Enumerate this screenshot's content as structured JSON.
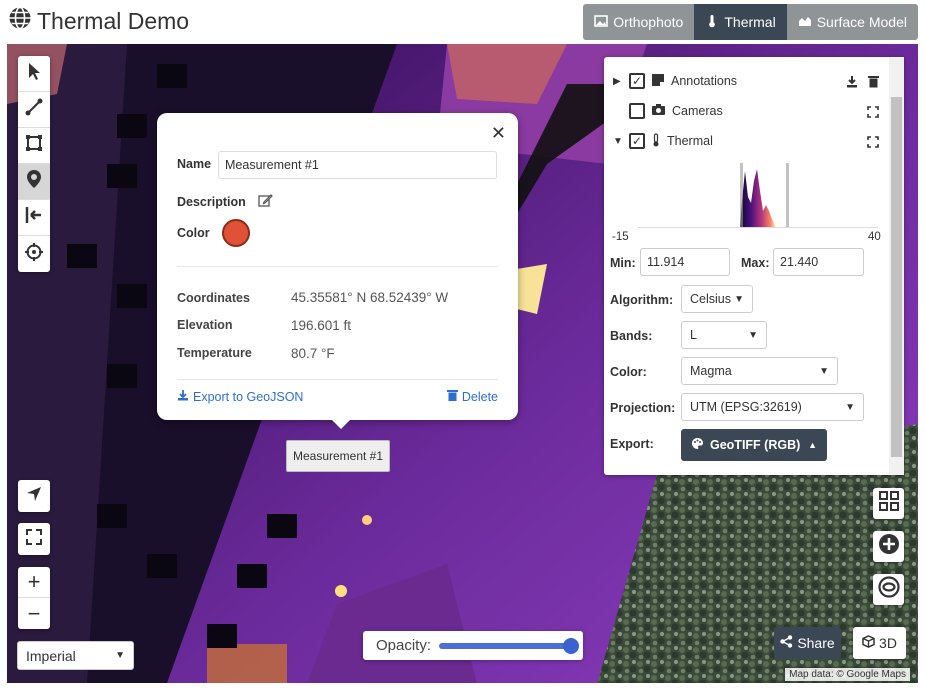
{
  "app": {
    "title": "Thermal Demo"
  },
  "modes": [
    {
      "label": "Orthophoto",
      "active": false
    },
    {
      "label": "Thermal",
      "active": true
    },
    {
      "label": "Surface Model",
      "active": false
    }
  ],
  "popup": {
    "name_label": "Name",
    "name_value": "Measurement #1",
    "description_label": "Description",
    "color_label": "Color",
    "color_value": "#e05236",
    "coordinates_label": "Coordinates",
    "coordinates_value": "45.35581° N 68.52439° W",
    "elevation_label": "Elevation",
    "elevation_value": "196.601 ft",
    "temperature_label": "Temperature",
    "temperature_value": "80.7 °F",
    "export_label": "Export to GeoJSON",
    "delete_label": "Delete"
  },
  "marker_tag": "Measurement #1",
  "layers": {
    "items": [
      {
        "label": "Annotations",
        "checked": true
      },
      {
        "label": "Cameras",
        "checked": false
      },
      {
        "label": "Thermal",
        "checked": true
      }
    ],
    "histogram_min_label": "-15",
    "histogram_max_label": "40",
    "min_label": "Min:",
    "min_value": "11.914",
    "max_label": "Max:",
    "max_value": "21.440",
    "algorithm_label": "Algorithm:",
    "algorithm_value": "Celsius",
    "bands_label": "Bands:",
    "bands_value": "L",
    "color_label": "Color:",
    "color_value": "Magma",
    "projection_label": "Projection:",
    "projection_value": "UTM (EPSG:32619)",
    "export_label": "Export:",
    "export_value": "GeoTIFF (RGB)"
  },
  "controls": {
    "units_value": "Imperial",
    "opacity_label": "Opacity:",
    "opacity_value": 1.0,
    "share_label": "Share",
    "view3d_label": "3D",
    "zoom_in": "+",
    "zoom_out": "−",
    "attribution": "Map data: © Google Maps"
  },
  "colors": {
    "accent": "#3c4755",
    "link": "#2d6fd0",
    "inactive_mode": "#8f9497"
  }
}
